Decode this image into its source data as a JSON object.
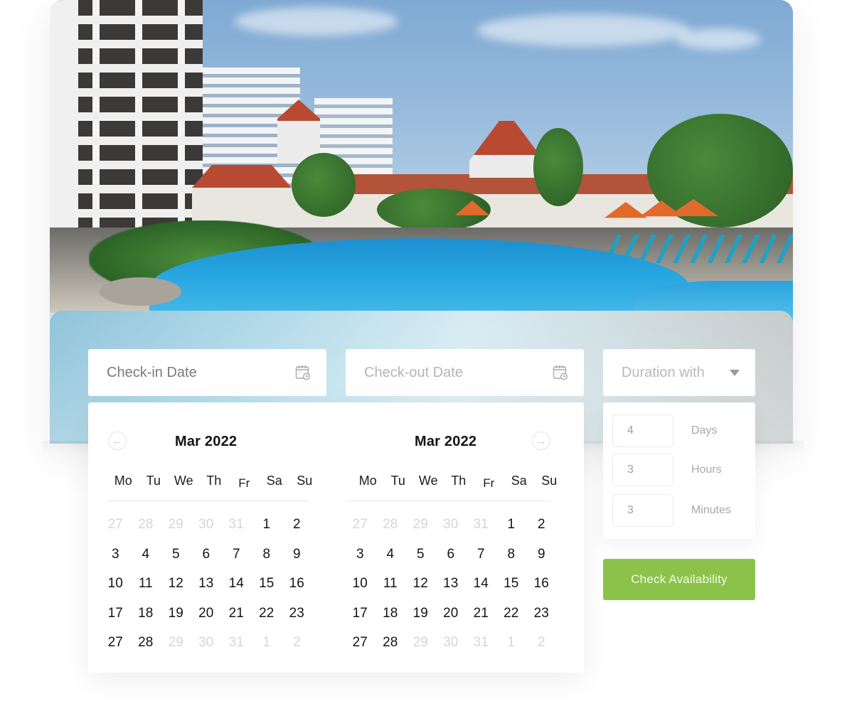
{
  "booking_form": {
    "checkin": {
      "placeholder": "Check-in Date",
      "icon": "calendar-clock-icon"
    },
    "checkout": {
      "placeholder": "Check-out Date",
      "icon": "calendar-clock-icon"
    },
    "duration_select": {
      "selected": "Duration with",
      "icon": "caret-down-icon"
    }
  },
  "calendar": {
    "prev_icon": "arrow-left-icon",
    "next_icon": "arrow-right-icon",
    "weekdays": [
      "Mo",
      "Tu",
      "We",
      "Th",
      "Fr",
      "Sa",
      "Su"
    ],
    "months": [
      {
        "title": "Mar 2022",
        "days": [
          {
            "d": "27",
            "muted": true
          },
          {
            "d": "28",
            "muted": true
          },
          {
            "d": "29",
            "muted": true
          },
          {
            "d": "30",
            "muted": true
          },
          {
            "d": "31",
            "muted": true
          },
          {
            "d": "1",
            "muted": false
          },
          {
            "d": "2",
            "muted": false
          },
          {
            "d": "3",
            "muted": false
          },
          {
            "d": "4",
            "muted": false
          },
          {
            "d": "5",
            "muted": false
          },
          {
            "d": "6",
            "muted": false
          },
          {
            "d": "7",
            "muted": false
          },
          {
            "d": "8",
            "muted": false
          },
          {
            "d": "9",
            "muted": false
          },
          {
            "d": "10",
            "muted": false
          },
          {
            "d": "11",
            "muted": false
          },
          {
            "d": "12",
            "muted": false
          },
          {
            "d": "13",
            "muted": false
          },
          {
            "d": "14",
            "muted": false
          },
          {
            "d": "15",
            "muted": false
          },
          {
            "d": "16",
            "muted": false
          },
          {
            "d": "17",
            "muted": false
          },
          {
            "d": "18",
            "muted": false
          },
          {
            "d": "19",
            "muted": false
          },
          {
            "d": "20",
            "muted": false
          },
          {
            "d": "21",
            "muted": false
          },
          {
            "d": "22",
            "muted": false
          },
          {
            "d": "23",
            "muted": false
          },
          {
            "d": "27",
            "muted": false
          },
          {
            "d": "28",
            "muted": false
          },
          {
            "d": "29",
            "muted": true
          },
          {
            "d": "30",
            "muted": true
          },
          {
            "d": "31",
            "muted": true
          },
          {
            "d": "1",
            "muted": true
          },
          {
            "d": "2",
            "muted": true
          }
        ]
      },
      {
        "title": "Mar 2022",
        "days": [
          {
            "d": "27",
            "muted": true
          },
          {
            "d": "28",
            "muted": true
          },
          {
            "d": "29",
            "muted": true
          },
          {
            "d": "30",
            "muted": true
          },
          {
            "d": "31",
            "muted": true
          },
          {
            "d": "1",
            "muted": false
          },
          {
            "d": "2",
            "muted": false
          },
          {
            "d": "3",
            "muted": false
          },
          {
            "d": "4",
            "muted": false
          },
          {
            "d": "5",
            "muted": false
          },
          {
            "d": "6",
            "muted": false
          },
          {
            "d": "7",
            "muted": false
          },
          {
            "d": "8",
            "muted": false
          },
          {
            "d": "9",
            "muted": false
          },
          {
            "d": "10",
            "muted": false
          },
          {
            "d": "11",
            "muted": false
          },
          {
            "d": "12",
            "muted": false
          },
          {
            "d": "13",
            "muted": false
          },
          {
            "d": "14",
            "muted": false
          },
          {
            "d": "15",
            "muted": false
          },
          {
            "d": "16",
            "muted": false
          },
          {
            "d": "17",
            "muted": false
          },
          {
            "d": "18",
            "muted": false
          },
          {
            "d": "19",
            "muted": false
          },
          {
            "d": "20",
            "muted": false
          },
          {
            "d": "21",
            "muted": false
          },
          {
            "d": "22",
            "muted": false
          },
          {
            "d": "23",
            "muted": false
          },
          {
            "d": "27",
            "muted": false
          },
          {
            "d": "28",
            "muted": false
          },
          {
            "d": "29",
            "muted": true
          },
          {
            "d": "30",
            "muted": true
          },
          {
            "d": "31",
            "muted": true
          },
          {
            "d": "1",
            "muted": true
          },
          {
            "d": "2",
            "muted": true
          }
        ]
      }
    ]
  },
  "duration": {
    "rows": [
      {
        "value": "4",
        "label": "Days"
      },
      {
        "value": "3",
        "label": "Hours"
      },
      {
        "value": "3",
        "label": "Minutes"
      }
    ]
  },
  "actions": {
    "check_availability": "Check Availability"
  },
  "colors": {
    "accent_green": "#8bc34a",
    "muted_day": "#d6d6d6",
    "text_dark": "#141414"
  },
  "hero": {
    "image_subject": "hotel-resort-pool-photo"
  }
}
